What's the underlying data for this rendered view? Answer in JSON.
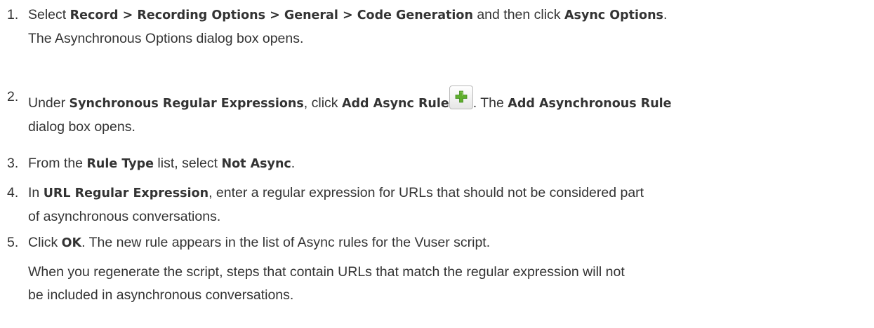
{
  "steps": [
    {
      "number": "1.",
      "line1": {
        "t1": "Select ",
        "b1": "Record > Recording Options > General > Code Generation",
        "t2": " and then click ",
        "b2": "Async Options",
        "t3": "."
      },
      "line2": "The Asynchronous Options dialog box opens."
    },
    {
      "number": "2.",
      "line1": {
        "t1": "Under ",
        "b1": "Synchronous Regular Expressions",
        "t2": ", click ",
        "b2": "Add Async Rule",
        "t3": ". The ",
        "b3": "Add Asynchronous Rule"
      },
      "line2": "dialog box opens.",
      "icon": "add-plus-icon",
      "icon_color": "#5fae2e"
    },
    {
      "number": "3.",
      "line1": {
        "t1": "From the ",
        "b1": "Rule Type",
        "t2": " list, select ",
        "b2": "Not Async",
        "t3": "."
      }
    },
    {
      "number": "4.",
      "line1": {
        "t1": "In ",
        "b1": "URL Regular Expression",
        "t2": ", enter a regular expression for URLs that should not be considered part"
      },
      "line2": "of asynchronous conversations."
    },
    {
      "number": "5.",
      "line1": {
        "t1": "Click ",
        "b1": "OK",
        "t2": ". The new rule appears in the list of Async rules for the Vuser script."
      },
      "note_line1": "When you regenerate the script, steps that contain URLs that match the regular expression will not",
      "note_line2": "be included in asynchronous conversations."
    }
  ]
}
